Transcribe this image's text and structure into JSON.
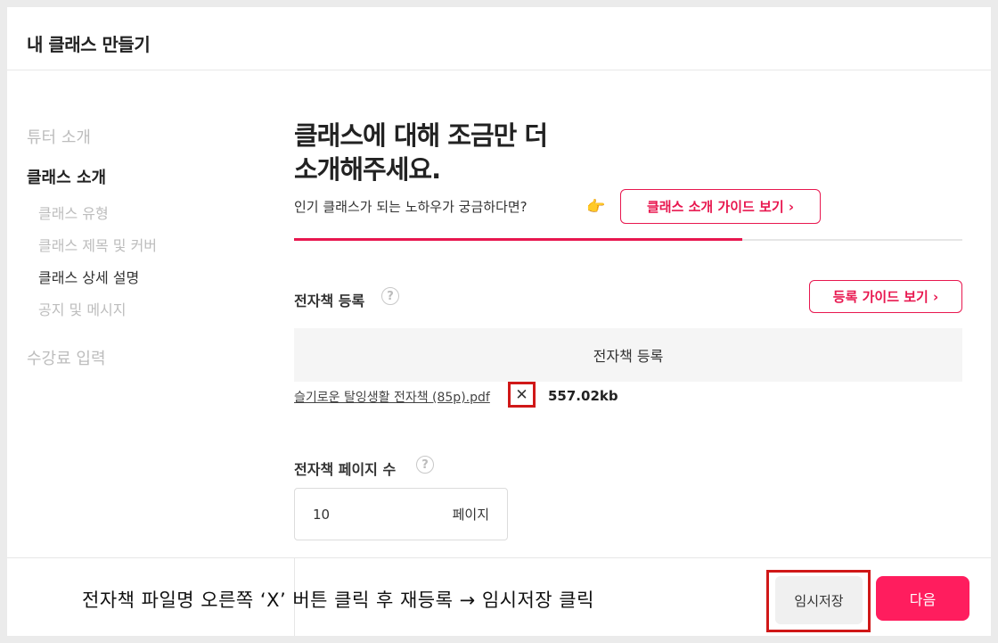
{
  "header": {
    "title": "내 클래스 만들기"
  },
  "sidebar": {
    "sections": [
      {
        "label": "튜터 소개",
        "active": false
      },
      {
        "label": "클래스 소개",
        "active": true
      },
      {
        "label": "수강료 입력",
        "active": false
      }
    ],
    "sub_items": [
      {
        "label": "클래스 유형",
        "active": false
      },
      {
        "label": "클래스 제목 및 커버",
        "active": false
      },
      {
        "label": "클래스 상세 설명",
        "active": true
      },
      {
        "label": "공지 및 메시지",
        "active": false
      }
    ]
  },
  "main": {
    "title_line1": "클래스에 대해 조금만 더",
    "title_line2": "소개해주세요.",
    "subtitle": "인기 클래스가 되는 노하우가 궁금하다면?",
    "hand_icon": "pointing-hand-icon",
    "guide_button": "클래스 소개 가이드 보기 ›",
    "progress": 0.67
  },
  "ebook": {
    "label": "전자책 등록",
    "help": "?",
    "guide_button": "등록 가이드 보기 ›",
    "upload_label": "전자책 등록",
    "file_name": "슬기로운 탈잉생활 전자책 (85p).pdf",
    "remove_symbol": "✕",
    "file_size": "557.02kb"
  },
  "pages": {
    "label": "전자책 페이지 수",
    "help": "?",
    "value": "10",
    "unit": "페이지"
  },
  "footer": {
    "instruction": "전자책 파일명 오른쪽 ‘X’ 버튼 클릭 후 재등록 → 임시저장 클릭",
    "save_button": "임시저장",
    "next_button": "다음"
  },
  "colors": {
    "accent": "#e8174f",
    "next": "#ff1d5e",
    "highlight": "#d01818"
  }
}
